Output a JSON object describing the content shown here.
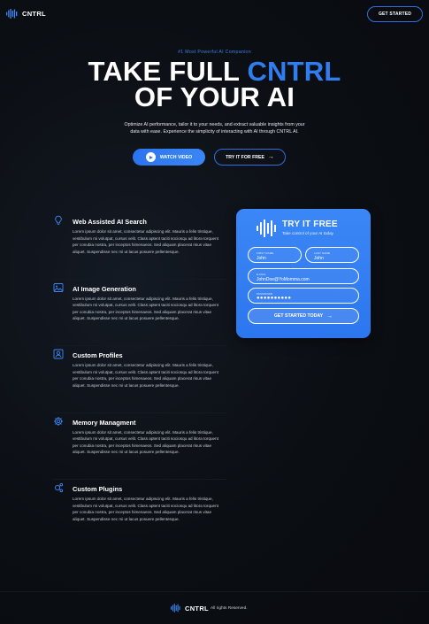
{
  "nav": {
    "brand": "CNTRL",
    "cta_label": "GET STARTED",
    "logo_icon": "soundwave-logo-icon"
  },
  "hero": {
    "eyebrow": "#1 Most Powerful AI Companion",
    "headline_line1_prefix": "TAKE FULL ",
    "headline_line1_accent": "CNTRL",
    "headline_line2": "OF YOUR AI",
    "subtext": "Optimize AI performance, tailor it to your needs, and extract valuable insights from your data with ease. Experience the simplicity of interacting with AI through CNTRL AI.",
    "watch_label": "WATCH VIDEO",
    "try_label": "TRY IT FOR FREE",
    "accent_color": "#2f7df0"
  },
  "features": [
    {
      "icon": "lightbulb-icon",
      "title": "Web Assisted AI Search",
      "body": "Lorem ipsum dolor sit amet, consectetur adipiscing elit. Mauris a felis tristique, vestibulum mi volutpat, cursus velit. Class aptent taciti sociosqu ad litora torquent per conubia nostra, per inceptos himenaeos. Sed aliquam placerat risus vitae aliquet. Suspendisse nec mi ut lacus posuere pellentesque."
    },
    {
      "icon": "image-icon",
      "title": "AI Image Generation",
      "body": "Lorem ipsum dolor sit amet, consectetur adipiscing elit. Mauris a felis tristique, vestibulum mi volutpat, cursus velit. Class aptent taciti sociosqu ad litora torquent per conubia nostra, per inceptos himenaeos. Sed aliquam placerat risus vitae aliquet. Suspendisse nec mi ut lacus posuere pellentesque."
    },
    {
      "icon": "profile-icon",
      "title": "Custom Profiles",
      "body": "Lorem ipsum dolor sit amet, consectetur adipiscing elit. Mauris a felis tristique, vestibulum mi volutpat, cursus velit. Class aptent taciti sociosqu ad litora torquent per conubia nostra, per inceptos himenaeos. Sed aliquam placerat risus vitae aliquet. Suspendisse nec mi ut lacus posuere pellentesque."
    },
    {
      "icon": "gear-icon",
      "title": "Memory Managment",
      "body": "Lorem ipsum dolor sit amet, consectetur adipiscing elit. Mauris a felis tristique, vestibulum mi volutpat, cursus velit. Class aptent taciti sociosqu ad litora torquent per conubia nostra, per inceptos himenaeos. Sed aliquam placerat risus vitae aliquet. Suspendisse nec mi ut lacus posuere pellentesque."
    },
    {
      "icon": "plugin-icon",
      "title": "Custom Plugins",
      "body": "Lorem ipsum dolor sit amet, consectetur adipiscing elit. Mauris a felis tristique, vestibulum mi volutpat, cursus velit. Class aptent taciti sociosqu ad litora torquent per conubia nostra, per inceptos himenaeos. Sed aliquam placerat risus vitae aliquet. Suspendisse nec mi ut lacus posuere pellentesque."
    }
  ],
  "form": {
    "title": "TRY IT FREE",
    "subtitle": "Take control of your AI today",
    "first_label": "FIRST NAME",
    "first_value": "John",
    "last_label": "LAST NAME",
    "last_value": "John",
    "email_label": "E-MAIL",
    "email_value": "JohnDoe@YoMomma.com",
    "password_label": "PASSWORD",
    "password_value": "●●●●●●●●●●",
    "submit_label": "GET STARTED TODAY",
    "card_color": "#3580f3"
  },
  "footer": {
    "brand": "CNTRL",
    "rights": "All rights Reserved."
  }
}
